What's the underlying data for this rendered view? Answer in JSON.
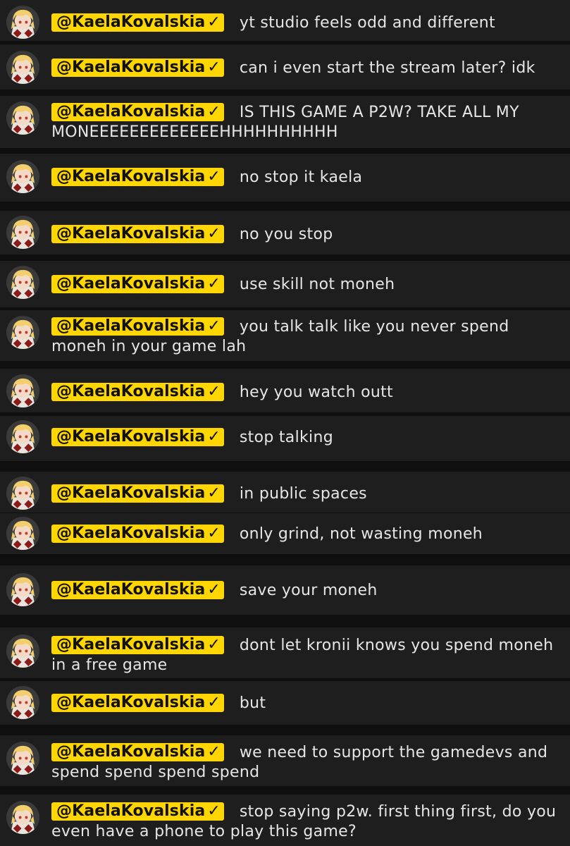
{
  "accent_color": "#ffd600",
  "avatar_icon": "user-avatar-icon",
  "verified_icon": "checkmark-icon",
  "messages": [
    {
      "author": "@KaelaKovalskia",
      "check": "✓",
      "text": "yt studio feels odd and different"
    },
    {
      "author": "@KaelaKovalskia",
      "check": "✓",
      "text": "can i even start the stream later? idk"
    },
    {
      "author": "@KaelaKovalskia",
      "check": "✓",
      "text": "IS THIS GAME A P2W? TAKE ALL MY MONEEEEEEEEEEEEEHHHHHHHHHH"
    },
    {
      "author": "@KaelaKovalskia",
      "check": "✓",
      "text": "no stop it kaela"
    },
    {
      "author": "@KaelaKovalskia",
      "check": "✓",
      "text": "no you stop"
    },
    {
      "author": "@KaelaKovalskia",
      "check": "✓",
      "text": "use skill not moneh"
    },
    {
      "author": "@KaelaKovalskia",
      "check": "✓",
      "text": "you talk talk like you never spend moneh in your game lah"
    },
    {
      "author": "@KaelaKovalskia",
      "check": "✓",
      "text": "hey you watch outt"
    },
    {
      "author": "@KaelaKovalskia",
      "check": "✓",
      "text": "stop talking"
    },
    {
      "author": "@KaelaKovalskia",
      "check": "✓",
      "text": "in public spaces"
    },
    {
      "author": "@KaelaKovalskia",
      "check": "✓",
      "text": "only grind, not wasting moneh"
    },
    {
      "author": "@KaelaKovalskia",
      "check": "✓",
      "text": "save your moneh"
    },
    {
      "author": "@KaelaKovalskia",
      "check": "✓",
      "text": "dont let kronii knows you spend moneh in a free game"
    },
    {
      "author": "@KaelaKovalskia",
      "check": "✓",
      "text": "but"
    },
    {
      "author": "@KaelaKovalskia",
      "check": "✓",
      "text": "we need to support the gamedevs and spend spend spend spend"
    },
    {
      "author": "@KaelaKovalskia",
      "check": "✓",
      "text": "stop saying p2w. first thing first, do you even have a phone to play this game?"
    }
  ]
}
